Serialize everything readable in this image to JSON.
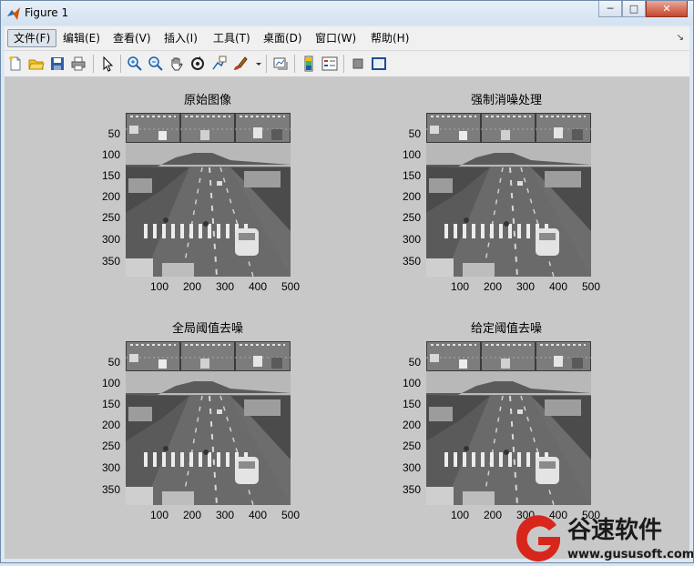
{
  "window": {
    "title": "Figure 1"
  },
  "menu": {
    "items": [
      "文件(F)",
      "编辑(E)",
      "查看(V)",
      "插入(I)",
      "工具(T)",
      "桌面(D)",
      "窗口(W)",
      "帮助(H)"
    ]
  },
  "toolbar": {
    "icons": [
      "new-file-icon",
      "open-folder-icon",
      "save-icon",
      "print-icon",
      "select-arrow-icon",
      "zoom-in-icon",
      "zoom-out-icon",
      "pan-hand-icon",
      "rotate-3d-icon",
      "data-cursor-icon",
      "brush-icon",
      "link-plot-icon",
      "colorbar-icon",
      "legend-icon",
      "hide-tools-icon",
      "show-tools-icon"
    ]
  },
  "plots": [
    {
      "title": "原始图像",
      "yticks": [
        "50",
        "100",
        "150",
        "200",
        "250",
        "300",
        "350"
      ],
      "xticks": [
        "100",
        "200",
        "300",
        "400",
        "500"
      ]
    },
    {
      "title": "强制消噪处理",
      "yticks": [
        "50",
        "100",
        "150",
        "200",
        "250",
        "300",
        "350"
      ],
      "xticks": [
        "100",
        "200",
        "300",
        "400",
        "500"
      ]
    },
    {
      "title": "全局阈值去噪",
      "yticks": [
        "50",
        "100",
        "150",
        "200",
        "250",
        "300",
        "350"
      ],
      "xticks": [
        "100",
        "200",
        "300",
        "400",
        "500"
      ]
    },
    {
      "title": "给定阈值去噪",
      "yticks": [
        "50",
        "100",
        "150",
        "200",
        "250",
        "300",
        "350"
      ],
      "xticks": [
        "100",
        "200",
        "300",
        "400",
        "500"
      ]
    }
  ],
  "watermark": {
    "brand": "谷速软件",
    "url": "www.gususoft.com"
  },
  "colors": {
    "figure_bg": "#c8c8c8",
    "logo_red": "#d7261b"
  }
}
